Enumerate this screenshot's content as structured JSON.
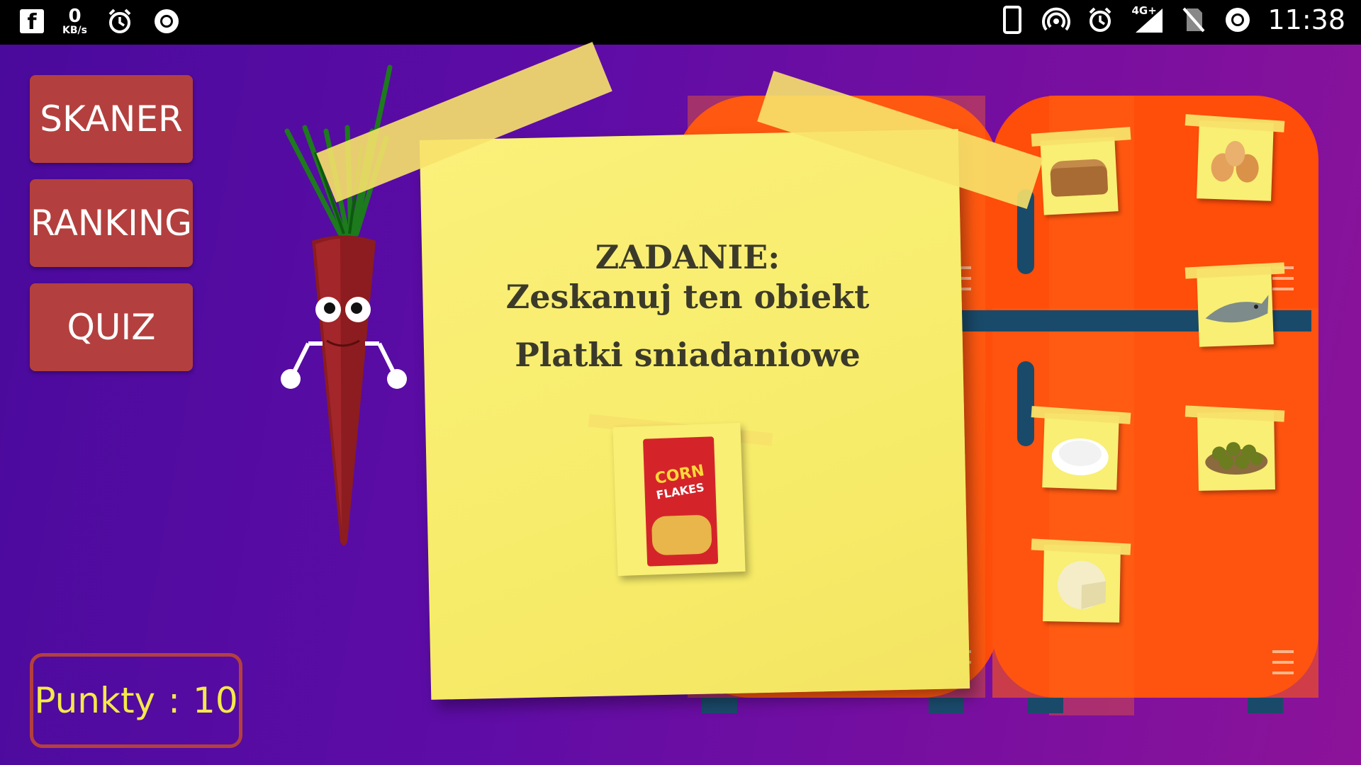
{
  "status_bar": {
    "left_icons": [
      "facebook-icon",
      "network-speed",
      "alarm-icon",
      "record-icon"
    ],
    "net_speed_value": "0",
    "net_speed_unit": "KB/s",
    "right_icons": [
      "phone-icon",
      "hotspot-icon",
      "alarm-icon",
      "signal-4g-icon",
      "no-sim-icon",
      "record-icon"
    ],
    "network_type": "4G+",
    "time": "11:38"
  },
  "menu": {
    "scanner_label": "SKANER",
    "ranking_label": "RANKING",
    "quiz_label": "QUIZ",
    "button_color": "#b3403e"
  },
  "score": {
    "label": "Punkty",
    "separator": ":",
    "value": "10",
    "text_color": "#f4e94a"
  },
  "task": {
    "title": "ZADANIE:",
    "instruction": "Zeskanuj ten obiekt",
    "item_name": "Platki sniadaniowe",
    "item_image": "corn-flakes-box",
    "item_box_text_1": "CORN",
    "item_box_text_2": "FLAKES"
  },
  "fridge": {
    "body_color": "#ff4d0a",
    "items": [
      "bread-icon",
      "eggs-icon",
      "fish-icon",
      "rice-icon",
      "olives-icon",
      "cheese-icon"
    ]
  }
}
